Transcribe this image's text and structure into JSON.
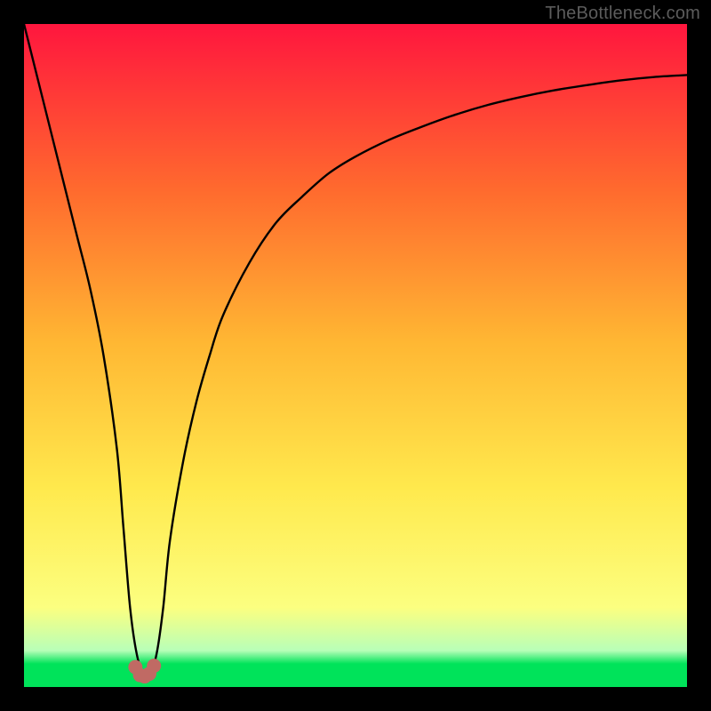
{
  "watermark": "TheBottleneck.com",
  "colors": {
    "frame": "#000000",
    "gradient_top": "#ff163e",
    "gradient_mid1": "#ff6a2e",
    "gradient_mid2": "#ffb733",
    "gradient_mid3": "#ffe94d",
    "gradient_mid4": "#fcff80",
    "gradient_bottom_band": "#b8ffb8",
    "gradient_green": "#00e35a",
    "curve": "#000000",
    "marker": "#c06a64"
  },
  "chart_data": {
    "type": "line",
    "title": "",
    "xlabel": "",
    "ylabel": "",
    "xlim": [
      0,
      100
    ],
    "ylim": [
      0,
      100
    ],
    "series": [
      {
        "name": "bottleneck-curve",
        "x": [
          0,
          2,
          4,
          6,
          8,
          10,
          12,
          14,
          15,
          16,
          17,
          18,
          19,
          20,
          21,
          22,
          24,
          26,
          28,
          30,
          34,
          38,
          42,
          46,
          50,
          55,
          60,
          65,
          70,
          75,
          80,
          85,
          90,
          95,
          100
        ],
        "y": [
          100,
          92,
          84,
          76,
          68,
          60,
          50,
          36,
          24,
          12,
          5,
          2,
          2,
          5,
          12,
          22,
          34,
          43,
          50,
          56,
          64,
          70,
          74,
          77.5,
          80,
          82.5,
          84.5,
          86.3,
          87.8,
          89,
          90,
          90.8,
          91.5,
          92,
          92.3
        ]
      }
    ],
    "markers": {
      "name": "min-cluster",
      "points": [
        {
          "x": 16.8,
          "y": 3.0
        },
        {
          "x": 17.5,
          "y": 1.8
        },
        {
          "x": 18.2,
          "y": 1.6
        },
        {
          "x": 18.9,
          "y": 2.0
        },
        {
          "x": 19.6,
          "y": 3.2
        }
      ],
      "radius_px": 8
    },
    "gradient_stops": [
      {
        "offset": 0.0,
        "color_key": "gradient_top"
      },
      {
        "offset": 0.25,
        "color_key": "gradient_mid1"
      },
      {
        "offset": 0.48,
        "color_key": "gradient_mid2"
      },
      {
        "offset": 0.7,
        "color_key": "gradient_mid3"
      },
      {
        "offset": 0.88,
        "color_key": "gradient_mid4"
      },
      {
        "offset": 0.945,
        "color_key": "gradient_bottom_band"
      },
      {
        "offset": 0.965,
        "color_key": "gradient_green"
      },
      {
        "offset": 1.0,
        "color_key": "gradient_green"
      }
    ]
  }
}
